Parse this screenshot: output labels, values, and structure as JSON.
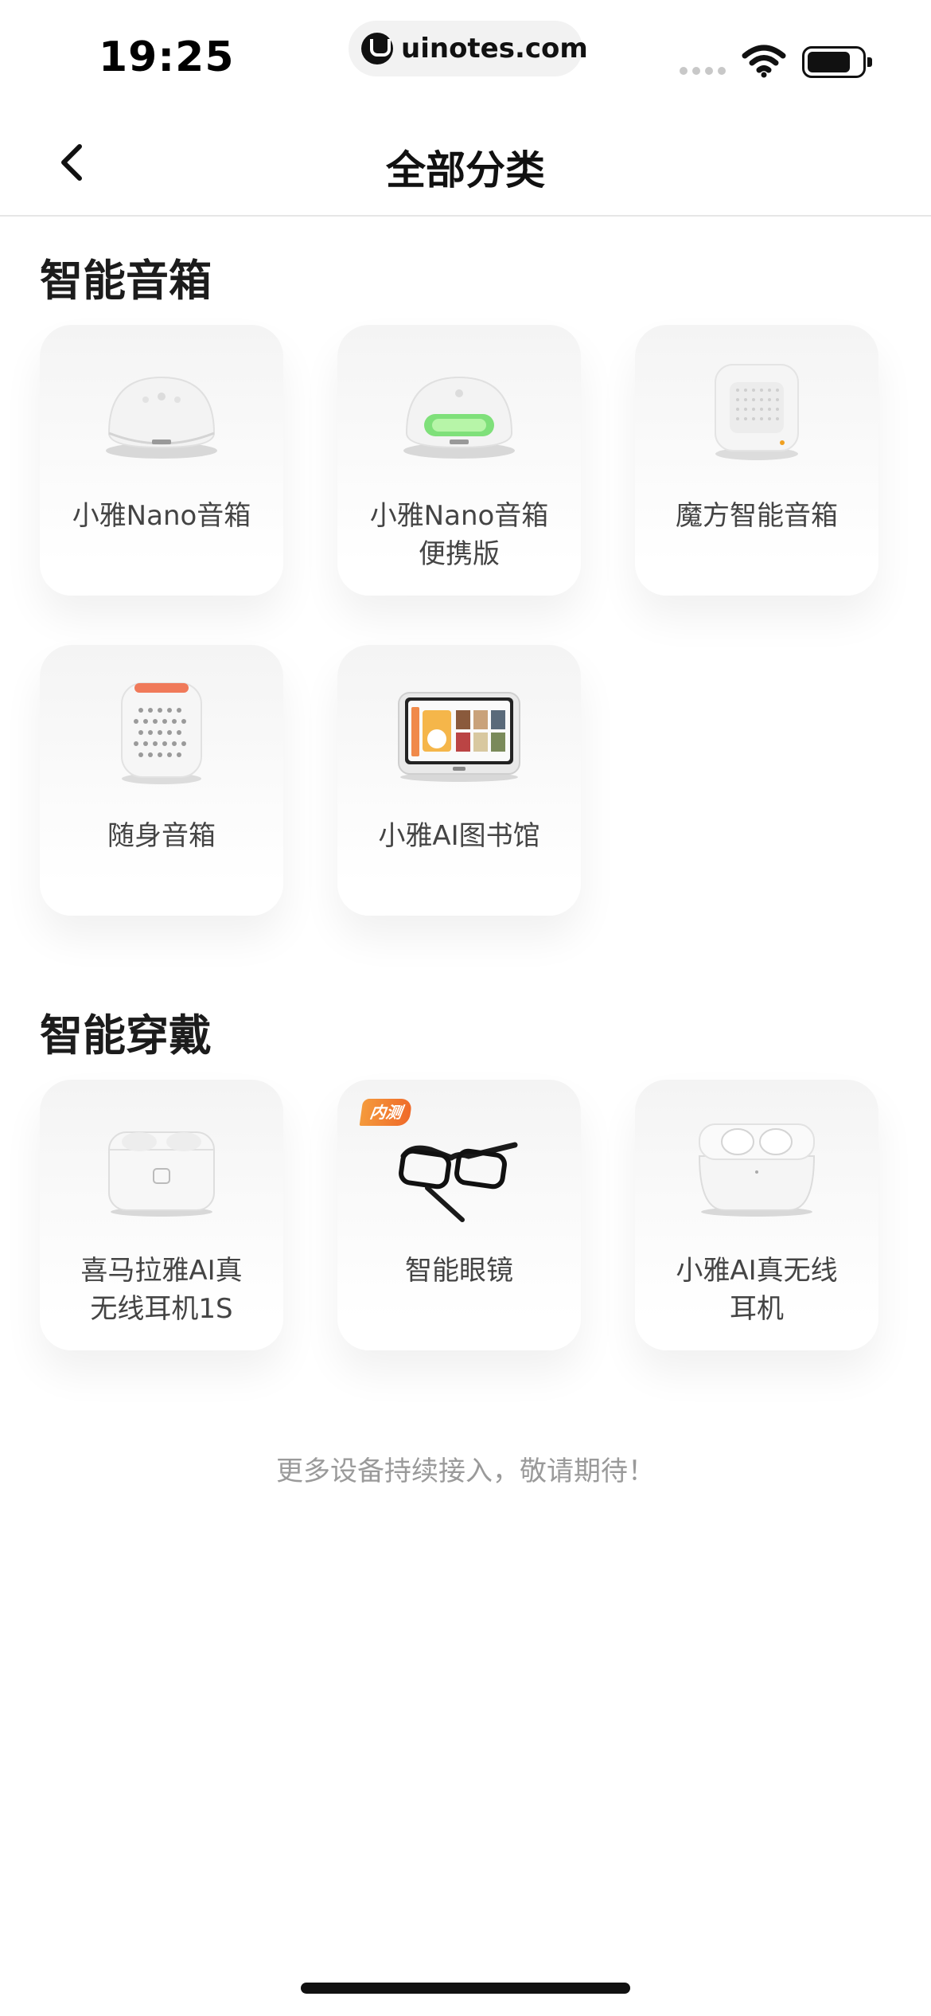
{
  "status_bar": {
    "time": "19:25",
    "url": "uinotes.com"
  },
  "nav": {
    "title": "全部分类"
  },
  "sections": [
    {
      "title": "智能音箱",
      "items": [
        {
          "label": "小雅Nano音箱",
          "icon": "smart-speaker-dome-icon"
        },
        {
          "label": "小雅Nano音箱\n便携版",
          "icon": "portable-speaker-green-icon"
        },
        {
          "label": "魔方智能音箱",
          "icon": "cube-speaker-icon"
        },
        {
          "label": "随身音箱",
          "icon": "pocket-speaker-icon"
        },
        {
          "label": "小雅AI图书馆",
          "icon": "smart-display-icon"
        }
      ]
    },
    {
      "title": "智能穿戴",
      "items": [
        {
          "label": "喜马拉雅AI真\n无线耳机1S",
          "icon": "earbuds-case-icon"
        },
        {
          "label": "智能眼镜",
          "icon": "smart-glasses-icon",
          "badge": "内测"
        },
        {
          "label": "小雅AI真无线\n耳机",
          "icon": "earbuds-white-icon"
        }
      ]
    }
  ],
  "footer": {
    "note": "更多设备持续接入，敬请期待！"
  }
}
